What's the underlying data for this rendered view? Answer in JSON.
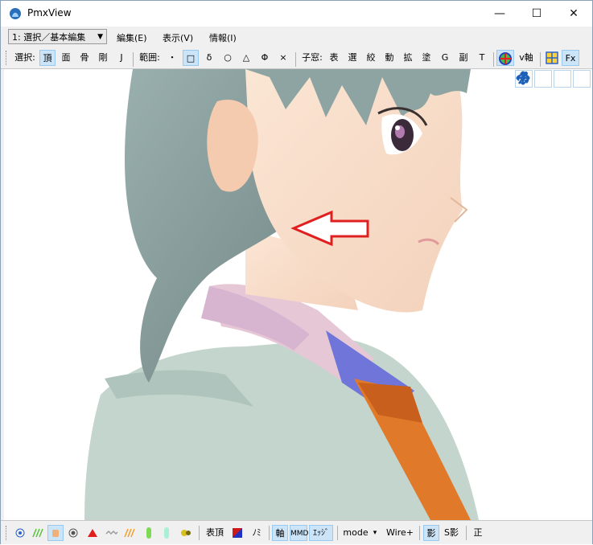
{
  "window": {
    "title": "PmxView",
    "controls": {
      "minimize": "—",
      "maximize": "☐",
      "close": "✕"
    }
  },
  "menubar": {
    "mode_select": "1: 選択／基本編集",
    "items": [
      "編集(E)",
      "表示(V)",
      "情報(I)"
    ]
  },
  "toolbar": {
    "select_label": "選択:",
    "select_buttons": [
      "頂",
      "面",
      "骨",
      "剛",
      "J"
    ],
    "range_label": "範囲:",
    "range_buttons": [
      "・",
      "□",
      "δ",
      "○",
      "△",
      "Φ",
      "×"
    ],
    "subwin_label": "子窓:",
    "subwin_buttons": [
      "表",
      "選",
      "絞",
      "動",
      "拡",
      "塗",
      "G",
      "副",
      "T"
    ],
    "vaxis_label": "v軸",
    "fx_label": "Fx"
  },
  "bottombar": {
    "table_vertex": "表頂",
    "nomi": "ﾉﾐ",
    "axis": "軸",
    "mmd": "MMD",
    "edge": "ｴｯｼﾞ",
    "mode": "mode",
    "mode_arrow": "▾",
    "wire": "Wire+",
    "shadow": "影",
    "sshadow": "S影",
    "sei": "正"
  },
  "colors": {
    "accent_active": "#cce4f7",
    "arrow": "#e02020",
    "hair": "#8fa3a3",
    "skin": "#fbe3cf",
    "uniform": "#c2d4cc",
    "tie": "#e07a2a"
  }
}
